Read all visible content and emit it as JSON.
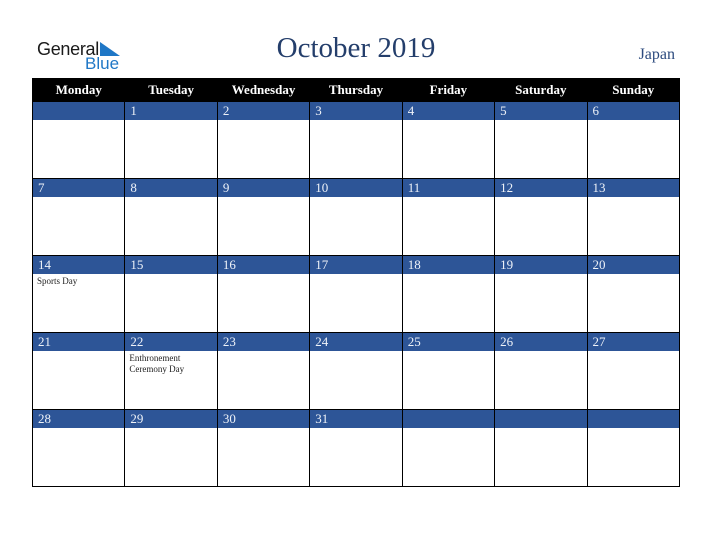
{
  "logo": {
    "general": "General",
    "blue": "Blue"
  },
  "header": {
    "title": "October 2019",
    "country": "Japan"
  },
  "weekdays": [
    "Monday",
    "Tuesday",
    "Wednesday",
    "Thursday",
    "Friday",
    "Saturday",
    "Sunday"
  ],
  "weeks": [
    [
      {
        "day": "",
        "event": ""
      },
      {
        "day": "1",
        "event": ""
      },
      {
        "day": "2",
        "event": ""
      },
      {
        "day": "3",
        "event": ""
      },
      {
        "day": "4",
        "event": ""
      },
      {
        "day": "5",
        "event": ""
      },
      {
        "day": "6",
        "event": ""
      }
    ],
    [
      {
        "day": "7",
        "event": ""
      },
      {
        "day": "8",
        "event": ""
      },
      {
        "day": "9",
        "event": ""
      },
      {
        "day": "10",
        "event": ""
      },
      {
        "day": "11",
        "event": ""
      },
      {
        "day": "12",
        "event": ""
      },
      {
        "day": "13",
        "event": ""
      }
    ],
    [
      {
        "day": "14",
        "event": "Sports Day"
      },
      {
        "day": "15",
        "event": ""
      },
      {
        "day": "16",
        "event": ""
      },
      {
        "day": "17",
        "event": ""
      },
      {
        "day": "18",
        "event": ""
      },
      {
        "day": "19",
        "event": ""
      },
      {
        "day": "20",
        "event": ""
      }
    ],
    [
      {
        "day": "21",
        "event": ""
      },
      {
        "day": "22",
        "event": "Enthronement Ceremony Day"
      },
      {
        "day": "23",
        "event": ""
      },
      {
        "day": "24",
        "event": ""
      },
      {
        "day": "25",
        "event": ""
      },
      {
        "day": "26",
        "event": ""
      },
      {
        "day": "27",
        "event": ""
      }
    ],
    [
      {
        "day": "28",
        "event": ""
      },
      {
        "day": "29",
        "event": ""
      },
      {
        "day": "30",
        "event": ""
      },
      {
        "day": "31",
        "event": ""
      },
      {
        "day": "",
        "event": ""
      },
      {
        "day": "",
        "event": ""
      },
      {
        "day": "",
        "event": ""
      }
    ]
  ],
  "colors": {
    "header_bg": "#000000",
    "daynum_bg": "#2d5597",
    "title": "#243e6b",
    "logo_blue": "#1f77c6"
  }
}
